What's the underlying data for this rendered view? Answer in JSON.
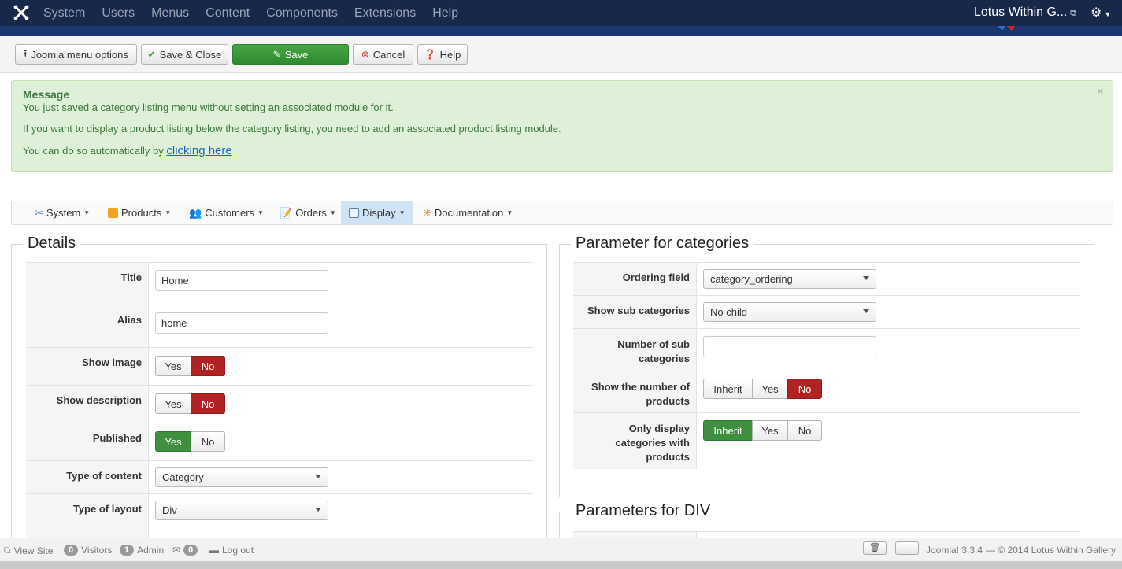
{
  "topbar": {
    "menu": [
      "System",
      "Users",
      "Menus",
      "Content",
      "Components",
      "Extensions",
      "Help"
    ],
    "site_name": "Lotus Within G...",
    "colors": {
      "bg": "#17284a",
      "muted": "#99a3b5"
    }
  },
  "toolbar": {
    "joomla_menu_options": "Joomla menu options",
    "save_close": "Save & Close",
    "save": "Save",
    "cancel": "Cancel",
    "help": "Help"
  },
  "message": {
    "heading": "Message",
    "line1": "You just saved a category listing menu without setting an associated module for it.",
    "line2": "If you want to display a product listing below the category listing, you need to add an associated product listing module.",
    "line3_prefix": "You can do so automatically by ",
    "line3_link": "clicking here",
    "close": "×"
  },
  "component_menu": {
    "items": [
      "System",
      "Products",
      "Customers",
      "Orders",
      "Display",
      "Documentation"
    ],
    "active": "Display"
  },
  "details": {
    "legend": "Details",
    "title_label": "Title",
    "title_value": "Home",
    "alias_label": "Alias",
    "alias_value": "home",
    "show_image_label": "Show image",
    "show_description_label": "Show description",
    "published_label": "Published",
    "type_content_label": "Type of content",
    "type_content_value": "Category",
    "type_layout_label": "Type of layout",
    "type_layout_value": "Div",
    "yes": "Yes",
    "no": "No"
  },
  "categories": {
    "legend": "Parameter for categories",
    "ordering_label": "Ordering field",
    "ordering_value": "category_ordering",
    "sub_label": "Show sub categories",
    "sub_value": "No child",
    "number_sub_label_1": "Number of sub",
    "number_sub_label_2": "categories",
    "number_sub_value": "",
    "show_number_label_1": "Show the number of",
    "show_number_label_2": "products",
    "only_display_label_1": "Only display",
    "only_display_label_2": "categories with",
    "only_display_label_3": "products",
    "inherit": "Inherit",
    "yes": "Yes",
    "no": "No"
  },
  "div_params": {
    "legend": "Parameters for DIV"
  },
  "statusbar": {
    "view_site": "View Site",
    "visitors_count": "0",
    "visitors_label": "Visitors",
    "admin_count": "1",
    "admin_label": "Admin",
    "messages_count": "0",
    "logout": "Log out",
    "version": "Joomla! 3.3.4",
    "copyright": "— © 2014 Lotus Within Gallery"
  }
}
